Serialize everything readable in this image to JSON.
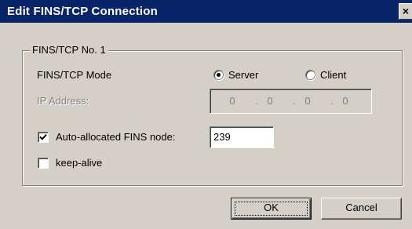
{
  "dialog": {
    "title": "Edit FINS/TCP Connection",
    "close_glyph": "×"
  },
  "group": {
    "legend": "FINS/TCP No. 1",
    "mode_label": "FINS/TCP Mode",
    "mode_options": [
      {
        "label": "Server",
        "selected": true
      },
      {
        "label": "Client",
        "selected": false
      }
    ],
    "ip_label": "IP Address:",
    "ip_segments": [
      "0",
      "0",
      "0",
      "0"
    ],
    "ip_separator": ".",
    "auto_fins": {
      "label": "Auto-allocated FINS node:",
      "checked": true,
      "value": "239"
    },
    "keep_alive": {
      "label": "keep-alive",
      "checked": false
    }
  },
  "buttons": {
    "ok": "OK",
    "cancel": "Cancel"
  },
  "colors": {
    "titlebar": "#0a246a",
    "face": "#d4d0c8",
    "disabled_text": "#808080"
  }
}
